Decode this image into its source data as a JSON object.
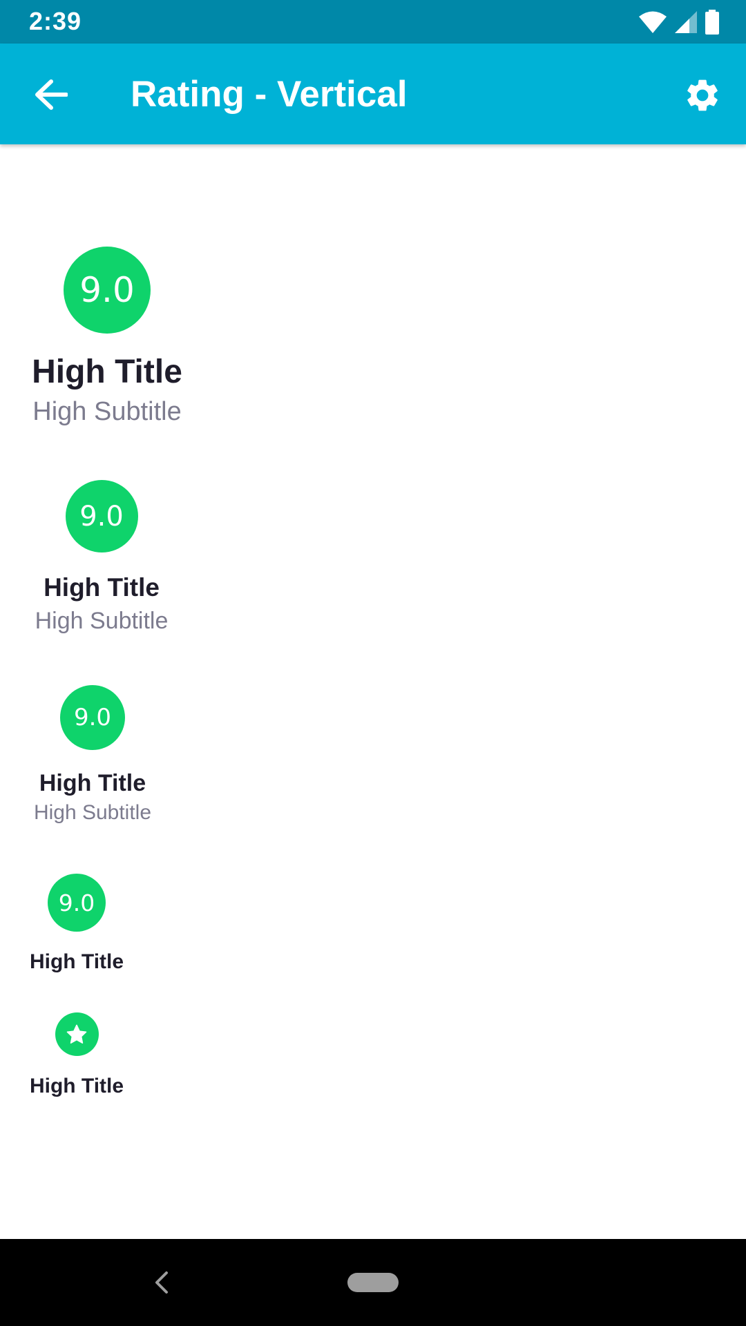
{
  "status_bar": {
    "time": "2:39",
    "icons": [
      "wifi-icon",
      "cellular-signal-icon",
      "battery-icon"
    ]
  },
  "app_bar": {
    "title": "Rating - Vertical",
    "back_icon": "arrow-left-icon",
    "settings_icon": "gear-icon"
  },
  "colors": {
    "status_bar": "#0088a8",
    "app_bar": "#00b2d6",
    "badge": "#0fd36b",
    "title_text": "#1f1d2b",
    "subtitle_text": "#7c7b8e"
  },
  "ratings": [
    {
      "value": "9.0",
      "title": "High Title",
      "subtitle": "High Subtitle"
    },
    {
      "value": "9.0",
      "title": "High Title",
      "subtitle": "High Subtitle"
    },
    {
      "value": "9.0",
      "title": "High Title",
      "subtitle": "High Subtitle"
    },
    {
      "value": "9.0",
      "title": "High Title"
    },
    {
      "icon": "star-icon",
      "title": "High Title"
    }
  ],
  "nav_bar": {
    "back_icon": "chevron-left-icon",
    "home_icon": "home-pill-icon"
  }
}
